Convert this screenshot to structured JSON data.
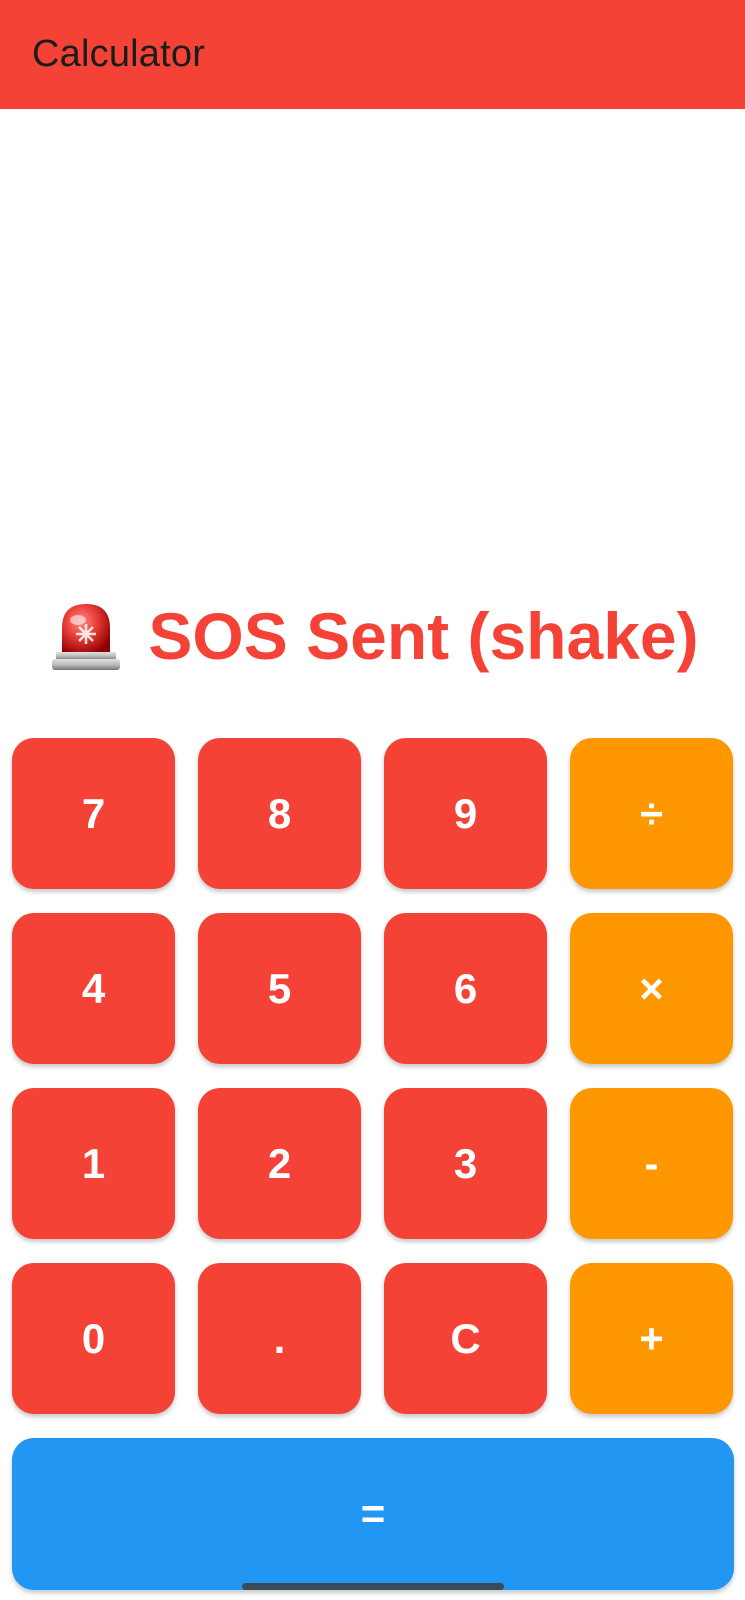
{
  "app_bar": {
    "title": "Calculator",
    "color": "#f44336"
  },
  "status": {
    "icon": "siren-icon",
    "text": "SOS Sent (shake)",
    "color": "#f44336"
  },
  "keypad": {
    "digit_color": "#f44336",
    "operator_color": "#ff9800",
    "rows": [
      [
        "7",
        "8",
        "9",
        "÷"
      ],
      [
        "4",
        "5",
        "6",
        "×"
      ],
      [
        "1",
        "2",
        "3",
        "-"
      ],
      [
        "0",
        ".",
        "C",
        "+"
      ]
    ]
  },
  "equals": {
    "label": "=",
    "color": "#2196f3"
  }
}
